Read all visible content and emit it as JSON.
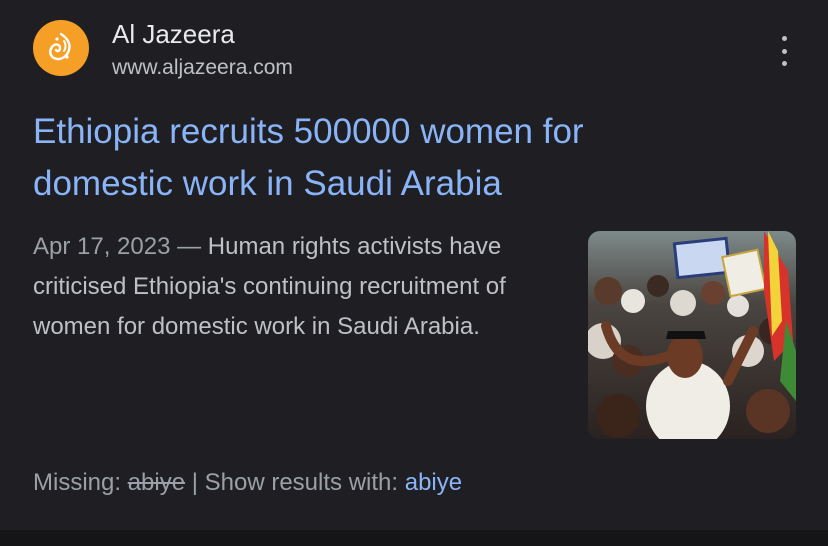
{
  "source": {
    "name": "Al Jazeera",
    "url": "www.aljazeera.com",
    "favicon_icon": "aljazeera-logo-icon",
    "favicon_color": "#f59f27"
  },
  "result": {
    "title_line1": "Ethiopia recruits 500000 women for",
    "title_line2": "domestic work in Saudi Arabia",
    "date": "Apr 17, 2023",
    "dash": " — ",
    "snippet": "Human rights activists have criticised Ethiopia's continuing recruitment of women for domestic work in Saudi Arabia."
  },
  "missing": {
    "label": "Missing: ",
    "term": "abiye",
    "separator": " | ",
    "show_label": "Show results with: ",
    "link": "abiye"
  },
  "colors": {
    "background": "#1f1f23",
    "title_link": "#8ab4f8",
    "text": "#bdc1c6"
  },
  "menu_icon": "more-vert-icon"
}
